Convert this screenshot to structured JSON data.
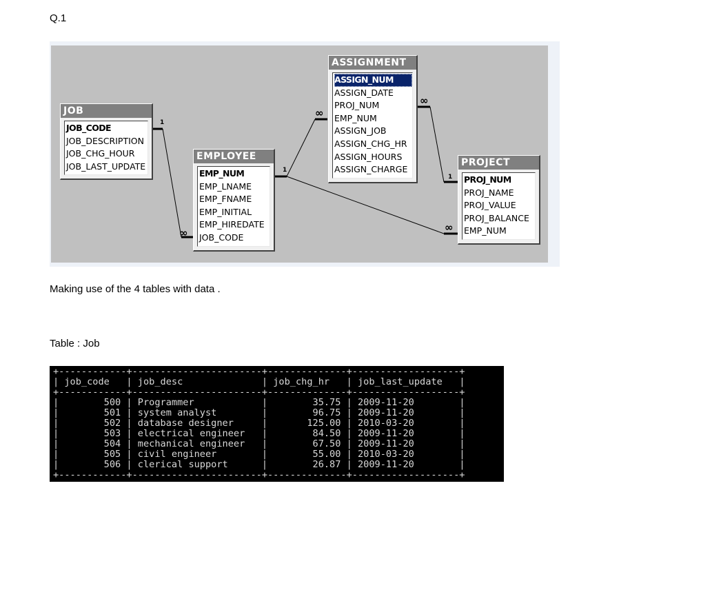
{
  "question_label": "Q.1",
  "intro_text": "Making use of the 4 tables with data .",
  "table_caption": "Table : Job",
  "diagram": {
    "job": {
      "title": "JOB",
      "fields": [
        "JOB_CODE",
        "JOB_DESCRIPTION",
        "JOB_CHG_HOUR",
        "JOB_LAST_UPDATE"
      ]
    },
    "employee": {
      "title": "EMPLOYEE",
      "fields": [
        "EMP_NUM",
        "EMP_LNAME",
        "EMP_FNAME",
        "EMP_INITIAL",
        "EMP_HIREDATE",
        "JOB_CODE"
      ]
    },
    "assignment": {
      "title": "ASSIGNMENT",
      "fields": [
        "ASSIGN_NUM",
        "ASSIGN_DATE",
        "PROJ_NUM",
        "EMP_NUM",
        "ASSIGN_JOB",
        "ASSIGN_CHG_HR",
        "ASSIGN_HOURS",
        "ASSIGN_CHARGE"
      ]
    },
    "project": {
      "title": "PROJECT",
      "fields": [
        "PROJ_NUM",
        "PROJ_NAME",
        "PROJ_VALUE",
        "PROJ_BALANCE",
        "EMP_NUM"
      ]
    },
    "one_label": "1",
    "many_label": "∞"
  },
  "job_table": {
    "columns": [
      "job_code",
      "job_desc",
      "job_chg_hr",
      "job_last_update"
    ],
    "rows": [
      [
        "500",
        "Programmer",
        "35.75",
        "2009-11-20"
      ],
      [
        "501",
        "system analyst",
        "96.75",
        "2009-11-20"
      ],
      [
        "502",
        "database designer",
        "125.00",
        "2010-03-20"
      ],
      [
        "503",
        "electrical engineer",
        "84.50",
        "2009-11-20"
      ],
      [
        "504",
        "mechanical engineer",
        "67.50",
        "2009-11-20"
      ],
      [
        "505",
        "civil engineer",
        "55.00",
        "2010-03-20"
      ],
      [
        "506",
        "clerical support",
        "26.87",
        "2009-11-20"
      ]
    ]
  }
}
